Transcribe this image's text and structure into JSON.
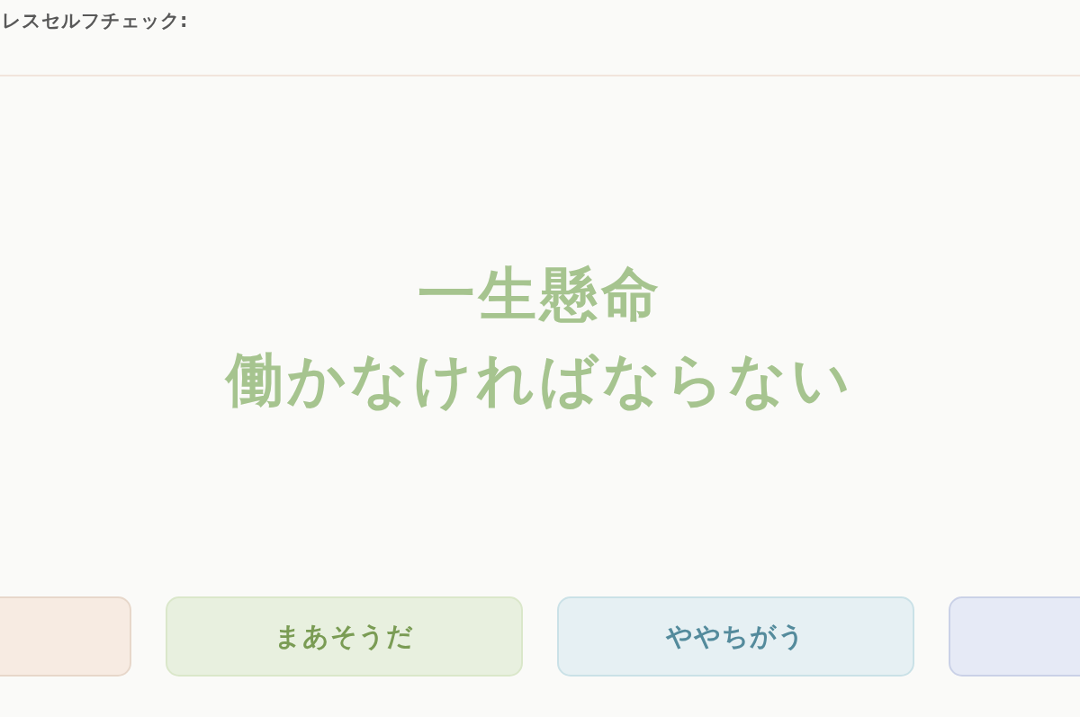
{
  "header": {
    "title": "レスセルフチェック:"
  },
  "question": {
    "lines": [
      "一生懸命",
      "働かなければならない"
    ]
  },
  "answers": [
    {
      "color": "#f7ebe2"
    },
    {
      "label": "まあそうだ",
      "color": "#e8f0df"
    },
    {
      "label": "ややちがう",
      "color": "#e6f0f3"
    },
    {
      "color": "#e6eaf6"
    }
  ]
}
